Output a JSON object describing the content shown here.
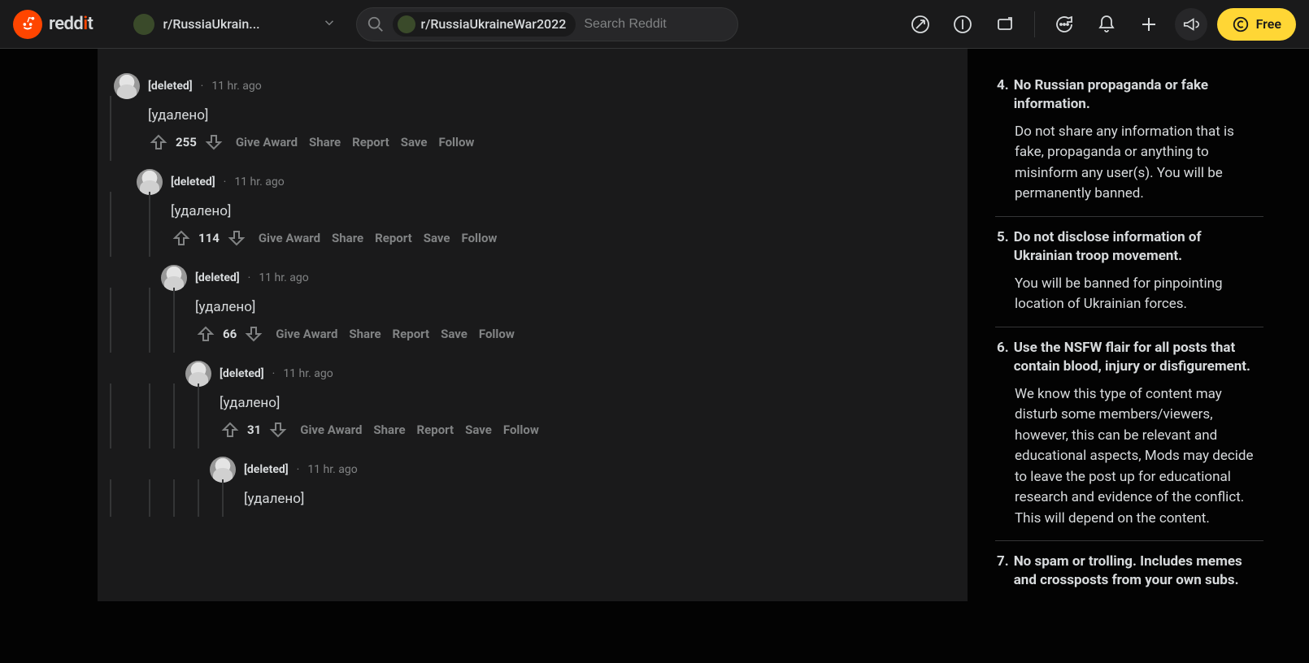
{
  "header": {
    "logo_text_pre": "redd",
    "logo_text_i": "i",
    "logo_text_post": "t",
    "subreddit_display": "r/RussiaUkrain...",
    "search_chip": "r/RussiaUkraineWar2022",
    "search_placeholder": "Search Reddit",
    "free_label": "Free"
  },
  "action_labels": {
    "award": "Give Award",
    "share": "Share",
    "report": "Report",
    "save": "Save",
    "follow": "Follow"
  },
  "comments": [
    {
      "author": "[deleted]",
      "time": "11 hr. ago",
      "body": "[удалено]",
      "score": "255"
    },
    {
      "author": "[deleted]",
      "time": "11 hr. ago",
      "body": "[удалено]",
      "score": "114"
    },
    {
      "author": "[deleted]",
      "time": "11 hr. ago",
      "body": "[удалено]",
      "score": "66"
    },
    {
      "author": "[deleted]",
      "time": "11 hr. ago",
      "body": "[удалено]",
      "score": "31"
    },
    {
      "author": "[deleted]",
      "time": "11 hr. ago",
      "body": "[удалено]",
      "score": ""
    }
  ],
  "rules": [
    {
      "num": "4.",
      "title": "No Russian propaganda or fake information.",
      "body": "Do not share any information that is fake, propaganda or anything to misinform any user(s). You will be permanently banned."
    },
    {
      "num": "5.",
      "title": "Do not disclose information of Ukrainian troop movement.",
      "body": "You will be banned for pinpointing location of Ukrainian forces."
    },
    {
      "num": "6.",
      "title": "Use the NSFW flair for all posts that contain blood, injury or disfigurement.",
      "body": "We know this type of content may disturb some members/viewers, however, this can be relevant and educational aspects, Mods may decide to leave the post up for educational research and evidence of the conflict. This will depend on the content."
    },
    {
      "num": "7.",
      "title": "No spam or trolling. Includes memes and crossposts from your own subs.",
      "body": ""
    }
  ]
}
